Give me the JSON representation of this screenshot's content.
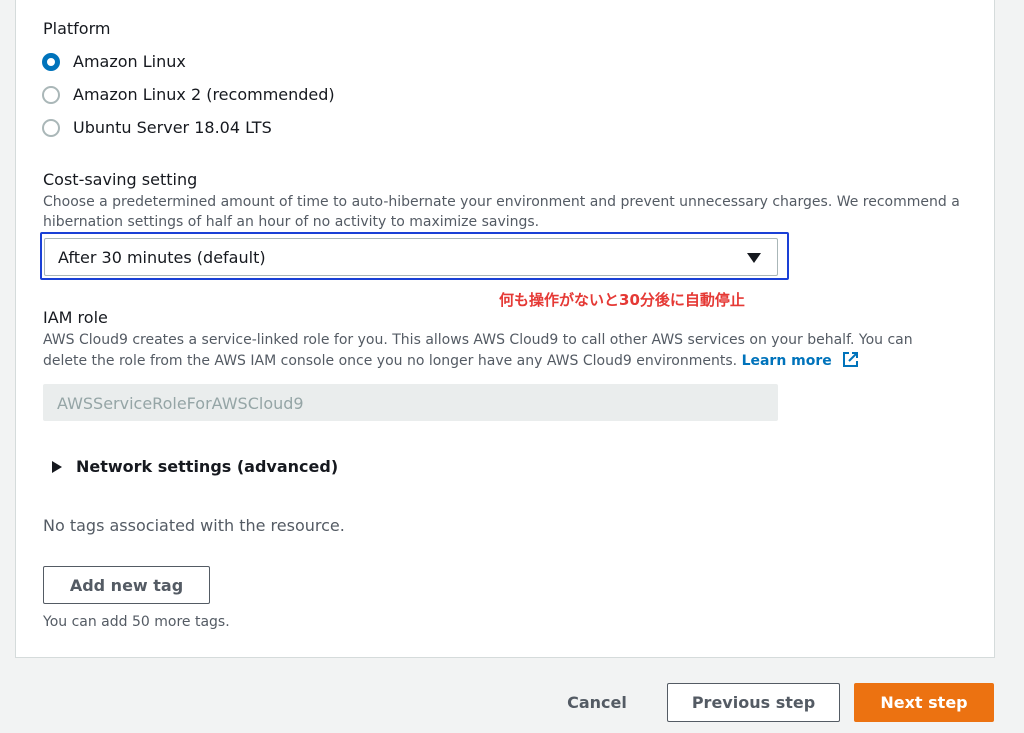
{
  "platform": {
    "label": "Platform",
    "options": [
      {
        "label": "Amazon Linux",
        "selected": true
      },
      {
        "label": "Amazon Linux 2 (recommended)",
        "selected": false
      },
      {
        "label": "Ubuntu Server 18.04 LTS",
        "selected": false
      }
    ]
  },
  "cost_saving": {
    "label": "Cost-saving setting",
    "description_line1": "Choose a predetermined amount of time to auto-hibernate your environment and prevent unnecessary charges. We recommend a",
    "description_line2": "hibernation settings of half an hour of no activity to maximize savings.",
    "selected_value": "After 30 minutes (default)",
    "highlight_color": "#1a40d6"
  },
  "annotation": {
    "text": "何も操作がないと30分後に自動停止",
    "color": "#e53935"
  },
  "iam_role": {
    "label": "IAM role",
    "description_line1": "AWS Cloud9 creates a service-linked role for you. This allows AWS Cloud9 to call other AWS services on your behalf. You can",
    "description_line2": "delete the role from the AWS IAM console once you no longer have any AWS Cloud9 environments.",
    "learn_more": "Learn more",
    "learn_more_icon": "external-link-icon",
    "value": "AWSServiceRoleForAWSCloud9"
  },
  "network": {
    "label": "Network settings (advanced)",
    "icon": "caret-right-icon"
  },
  "tags": {
    "empty_text": "No tags associated with the resource.",
    "add_button": "Add new tag",
    "hint": "You can add 50 more tags."
  },
  "footer": {
    "cancel": "Cancel",
    "previous": "Previous step",
    "next": "Next step",
    "primary_color": "#ec7211"
  }
}
